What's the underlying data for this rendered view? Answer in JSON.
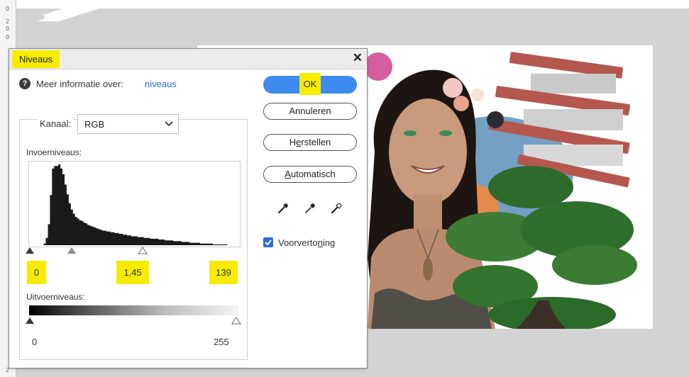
{
  "dialog": {
    "title": "Niveaus",
    "close_symbol": "✕",
    "help_text": "Meer informatie over:",
    "help_link": "niveaus",
    "channel_label": "Kanaal:",
    "channel_value": "RGB",
    "input_levels_label": "Invoerniveaus:",
    "input_black": "0",
    "input_gamma": "1,45",
    "input_white": "139",
    "output_levels_label": "Uitvoerniveaus:",
    "output_black": "0",
    "output_white": "255",
    "buttons": {
      "ok": "OK",
      "cancel": "Annuleren",
      "reset_pre": "H",
      "reset_u": "e",
      "reset_post": "rstellen",
      "auto_u": "A",
      "auto_post": "utomatisch"
    },
    "preview_pre": "Voorverto",
    "preview_u": "n",
    "preview_post": "ing",
    "preview_checked": true
  },
  "ruler": {
    "marks": [
      "0",
      "2",
      "0",
      "0"
    ],
    "bottom_mark": "2"
  },
  "colors": {
    "highlight": "#f7ec00",
    "ok_button": "#3d8bf0",
    "link": "#2a6fb5",
    "checkbox": "#2d6fd2"
  },
  "icons": [
    "help-icon",
    "close-icon",
    "chevron-down-icon",
    "eyedropper-black-icon",
    "eyedropper-gray-icon",
    "eyedropper-white-icon",
    "checkmark-icon"
  ],
  "histogram": [
    0,
    0,
    0,
    0,
    0,
    0,
    0,
    2,
    9,
    26,
    62,
    95,
    98,
    98,
    100,
    95,
    88,
    75,
    63,
    52,
    44,
    39,
    35,
    33,
    31,
    30,
    28,
    27,
    25,
    24,
    23,
    22,
    21,
    20,
    19,
    18,
    18,
    17,
    17,
    16,
    16,
    15,
    15,
    14,
    14,
    13,
    13,
    12,
    12,
    11,
    11,
    11,
    10,
    10,
    10,
    9,
    9,
    9,
    8,
    8,
    8,
    8,
    7,
    7,
    7,
    6,
    6,
    6,
    6,
    5,
    5,
    5,
    5,
    4,
    4,
    4,
    4,
    3,
    3,
    3,
    3,
    3,
    2,
    2,
    2,
    2,
    2,
    2,
    1,
    1,
    1,
    1,
    1,
    1,
    1,
    0,
    0,
    0,
    0,
    0,
    0
  ]
}
